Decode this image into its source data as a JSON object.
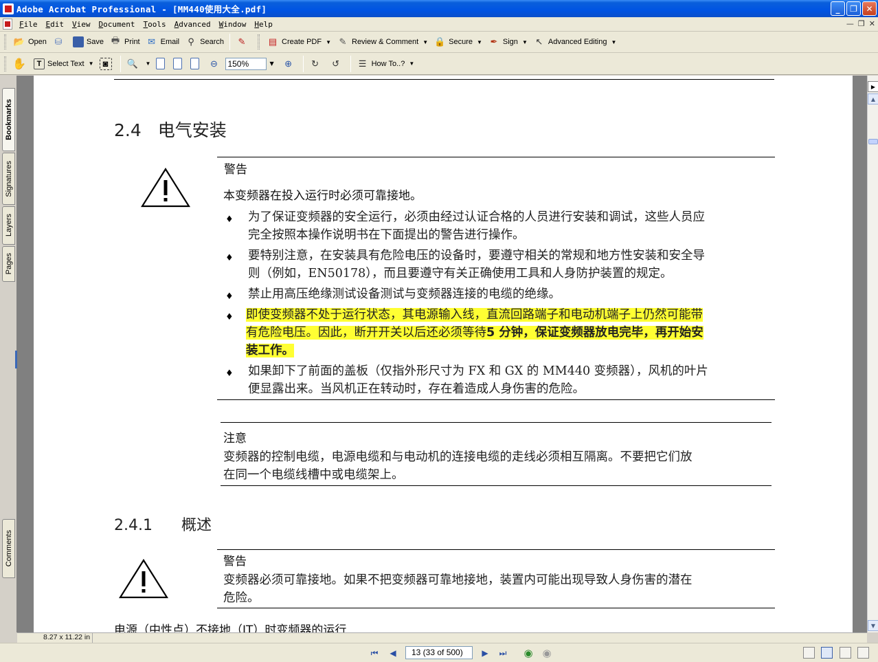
{
  "window": {
    "title": "Adobe Acrobat Professional - [MM440使用大全.pdf]",
    "buttons": {
      "minimize": "_",
      "restore": "❐",
      "close": "✕"
    }
  },
  "menu": [
    "File",
    "Edit",
    "View",
    "Document",
    "Tools",
    "Advanced",
    "Window",
    "Help"
  ],
  "toolbar1": {
    "open": "Open",
    "save": "Save",
    "print": "Print",
    "email": "Email",
    "search": "Search",
    "create_pdf": "Create PDF",
    "review": "Review & Comment",
    "secure": "Secure",
    "sign": "Sign",
    "advanced_editing": "Advanced Editing"
  },
  "toolbar2": {
    "select_text": "Select Text",
    "zoom": "150%",
    "how_to": "How To..?"
  },
  "nav_tabs": [
    "Bookmarks",
    "Signatures",
    "Layers",
    "Pages",
    "Comments"
  ],
  "doc": {
    "sec24_num": "2.4",
    "sec24_title": "电气安装",
    "warn1_label": "警告",
    "warn1_bold": "本变频器在投入运行时必须可靠接地。",
    "bullets": [
      {
        "line1": "为了保证变频器的安全运行，必须由经过认证合格的人员进行安装和调试，这些人员应",
        "line2": "完全按照本操作说明书在下面提出的警告进行操作。"
      },
      {
        "line1": "要特别注意，在安装具有危险电压的设备时，要遵守相关的常规和地方性安装和安全导",
        "line2": "则（例如，EN50178），而且要遵守有关正确使用工具和人身防护装置的规定。"
      },
      {
        "line1": "禁止用高压绝缘测试设备测试与变频器连接的电缆的绝缘。",
        "line2": ""
      },
      {
        "line1": "即使变频器不处于运行状态，其电源输入线，直流回路端子和电动机端子上仍然可能带",
        "line2a": "有危险电压。因此，断开开关以后还必须等待",
        "line2b": "5 分钟，保证变频器放电完毕，再开始安",
        "line3": "装工作。"
      },
      {
        "line1": "如果卸下了前面的盖板（仅指外形尺寸为 FX 和 GX 的 MM440 变频器），风机的叶片",
        "line2": "便显露出来。当风机正在转动时，存在着造成人身伤害的危险。"
      }
    ],
    "note_label": "注意",
    "note_bold": "变频器的控制电缆，电源电缆和与电动机的连接电缆的走线",
    "note_rest": "必须相互隔离。不要把它们放",
    "note_line2": "在同一个电缆线槽中或电缆架上。",
    "sec241_num": "2.4.1",
    "sec241_title": "概述",
    "warn2_label": "警告",
    "warn2_bold": "变频器必须可靠接地。",
    "warn2_rest": "如果不把变频器可靠地接地，装置内可能出现导致人身伤害的潜在",
    "warn2_line2": "危险。",
    "cut_line": "电源（中性点）不接地（IT）时变频器的运行"
  },
  "status": {
    "page_size": "8.27 x 11.22 in",
    "page_indicator": "13  (33 of 500)"
  },
  "colors": {
    "highlight": "#ffff33",
    "title_bar": "#0054e3"
  }
}
